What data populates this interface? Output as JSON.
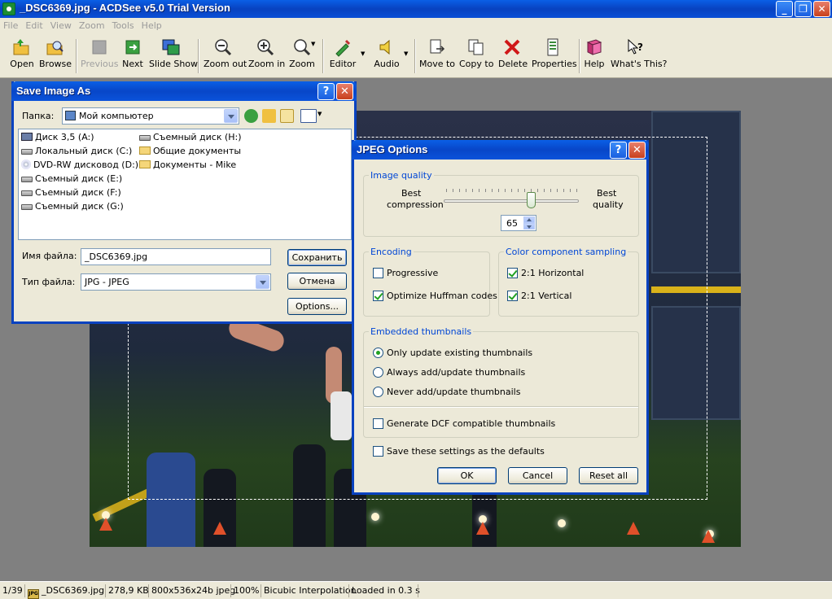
{
  "window": {
    "title": "_DSC6369.jpg - ACDSee v5.0 Trial Version"
  },
  "menu": [
    "File",
    "Edit",
    "View",
    "Zoom",
    "Tools",
    "Help"
  ],
  "toolbar": {
    "open": "Open",
    "browse": "Browse",
    "previous": "Previous",
    "next": "Next",
    "slideshow": "Slide Show",
    "zoom_out": "Zoom out",
    "zoom_in": "Zoom in",
    "zoom": "Zoom",
    "editor": "Editor",
    "audio": "Audio",
    "move_to": "Move to",
    "copy_to": "Copy to",
    "delete": "Delete",
    "properties": "Properties",
    "help": "Help",
    "whats_this": "What's This?"
  },
  "status": {
    "index": "1/39",
    "filename": "_DSC6369.jpg",
    "size": "278,9 KB",
    "dims": "800x536x24b jpeg",
    "zoom": "100%",
    "interp": "Bicubic Interpolation",
    "loaded": "Loaded in 0.3 s",
    "jpg_icon": "JPG"
  },
  "save_dialog": {
    "title": "Save Image As",
    "folder_label": "Папка:",
    "folder_value": "Мой компьютер",
    "items_col1": [
      "Диск 3,5 (A:)",
      "Локальный диск (C:)",
      "DVD-RW дисковод (D:)",
      "Съемный диск (E:)",
      "Съемный диск (F:)",
      "Съемный диск (G:)"
    ],
    "items_col2": [
      "Съемный диск (H:)",
      "Общие документы",
      "Документы - Mike"
    ],
    "filename_label": "Имя файла:",
    "filename_value": "_DSC6369.jpg",
    "filetype_label": "Тип файла:",
    "filetype_value": "JPG - JPEG",
    "save_btn": "Сохранить",
    "cancel_btn": "Отмена",
    "options_btn": "Options..."
  },
  "jpeg_dialog": {
    "title": "JPEG Options",
    "quality_group": "Image quality",
    "best_compression_1": "Best",
    "best_compression_2": "compression",
    "best_quality_1": "Best",
    "best_quality_2": "quality",
    "quality_value": "65",
    "encoding_group": "Encoding",
    "progressive": "Progressive",
    "optimize": "Optimize Huffman codes",
    "sampling_group": "Color component sampling",
    "horizontal": "2:1 Horizontal",
    "vertical": "2:1 Vertical",
    "thumbs_group": "Embedded thumbnails",
    "only_update": "Only update existing thumbnails",
    "always_add": "Always add/update thumbnails",
    "never_add": "Never add/update thumbnails",
    "dcf": "Generate DCF compatible thumbnails",
    "save_defaults": "Save these settings as the defaults",
    "ok": "OK",
    "cancel": "Cancel",
    "reset": "Reset all"
  },
  "common": {
    "help_glyph": "?",
    "close_glyph": "✕",
    "min_glyph": "_",
    "max_glyph": "❐"
  }
}
